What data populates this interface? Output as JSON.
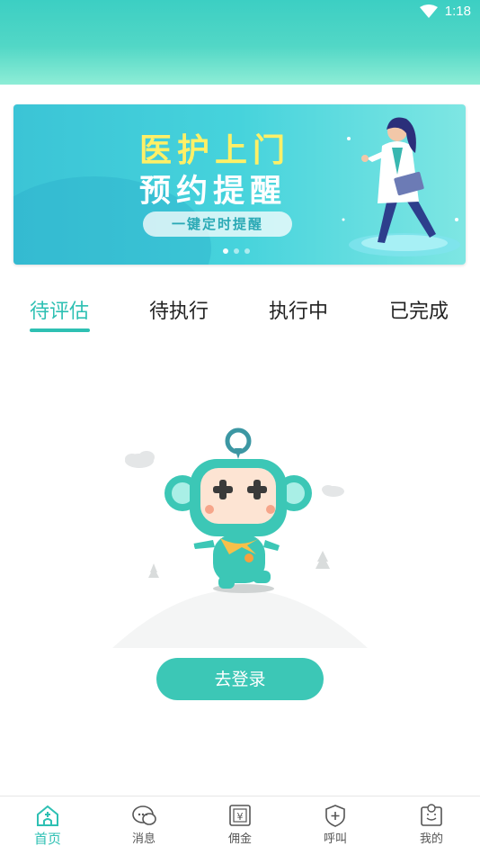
{
  "status_bar": {
    "time": "1:18"
  },
  "banner": {
    "title": "医护上门",
    "subtitle": "预约提醒",
    "pill_text": "一键定时提醒",
    "dots": 3,
    "active_dot": 0
  },
  "tabs": [
    {
      "label": "待评估",
      "active": true
    },
    {
      "label": "待执行",
      "active": false
    },
    {
      "label": "执行中",
      "active": false
    },
    {
      "label": "已完成",
      "active": false
    }
  ],
  "login_button": "去登录",
  "bottom_nav": [
    {
      "label": "首页",
      "icon": "home-icon",
      "active": true
    },
    {
      "label": "消息",
      "icon": "chat-icon",
      "active": false
    },
    {
      "label": "佣金",
      "icon": "yen-icon",
      "active": false
    },
    {
      "label": "呼叫",
      "icon": "shield-plus-icon",
      "active": false
    },
    {
      "label": "我的",
      "icon": "profile-icon",
      "active": false
    }
  ],
  "colors": {
    "accent": "#2ec0b3",
    "button": "#3cc7b6",
    "header_top": "#3ccfc3"
  }
}
